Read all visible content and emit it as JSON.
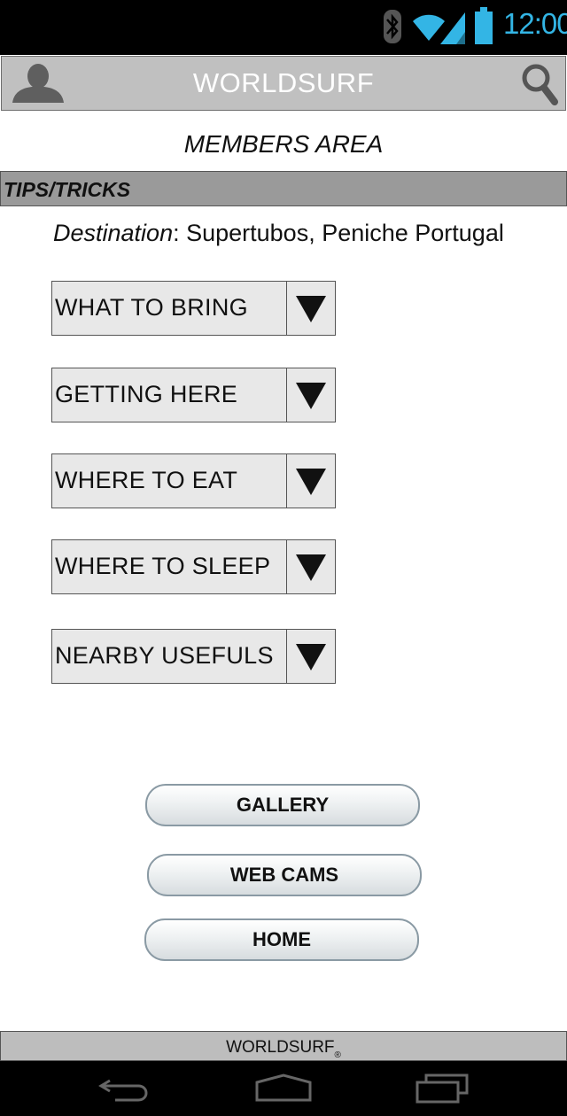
{
  "status_bar": {
    "time": "12:00",
    "icons": [
      "bluetooth-icon",
      "wifi-icon",
      "signal-icon",
      "battery-icon"
    ],
    "accent_color": "#33b5e5"
  },
  "app_bar": {
    "title": "WORLDSURF",
    "left_icon": "user-icon",
    "right_icon": "search-icon"
  },
  "page": {
    "section_title": "MEMBERS AREA",
    "tips_header": "TIPS/TRICKS",
    "destination_label": "Destination",
    "destination_value": ": Supertubos, Peniche Portugal"
  },
  "dropdowns": [
    {
      "label": "WHAT TO BRING"
    },
    {
      "label": "GETTING HERE"
    },
    {
      "label": "WHERE TO EAT"
    },
    {
      "label": "WHERE TO SLEEP"
    },
    {
      "label": "NEARBY USEFULS"
    }
  ],
  "buttons": {
    "gallery": "GALLERY",
    "webcams": "WEB CAMS",
    "home": "HOME"
  },
  "footer": {
    "text": "WORLDSURF",
    "mark": "®"
  },
  "nav_bar": {
    "icons": [
      "back-icon",
      "home-icon",
      "recent-apps-icon"
    ]
  }
}
